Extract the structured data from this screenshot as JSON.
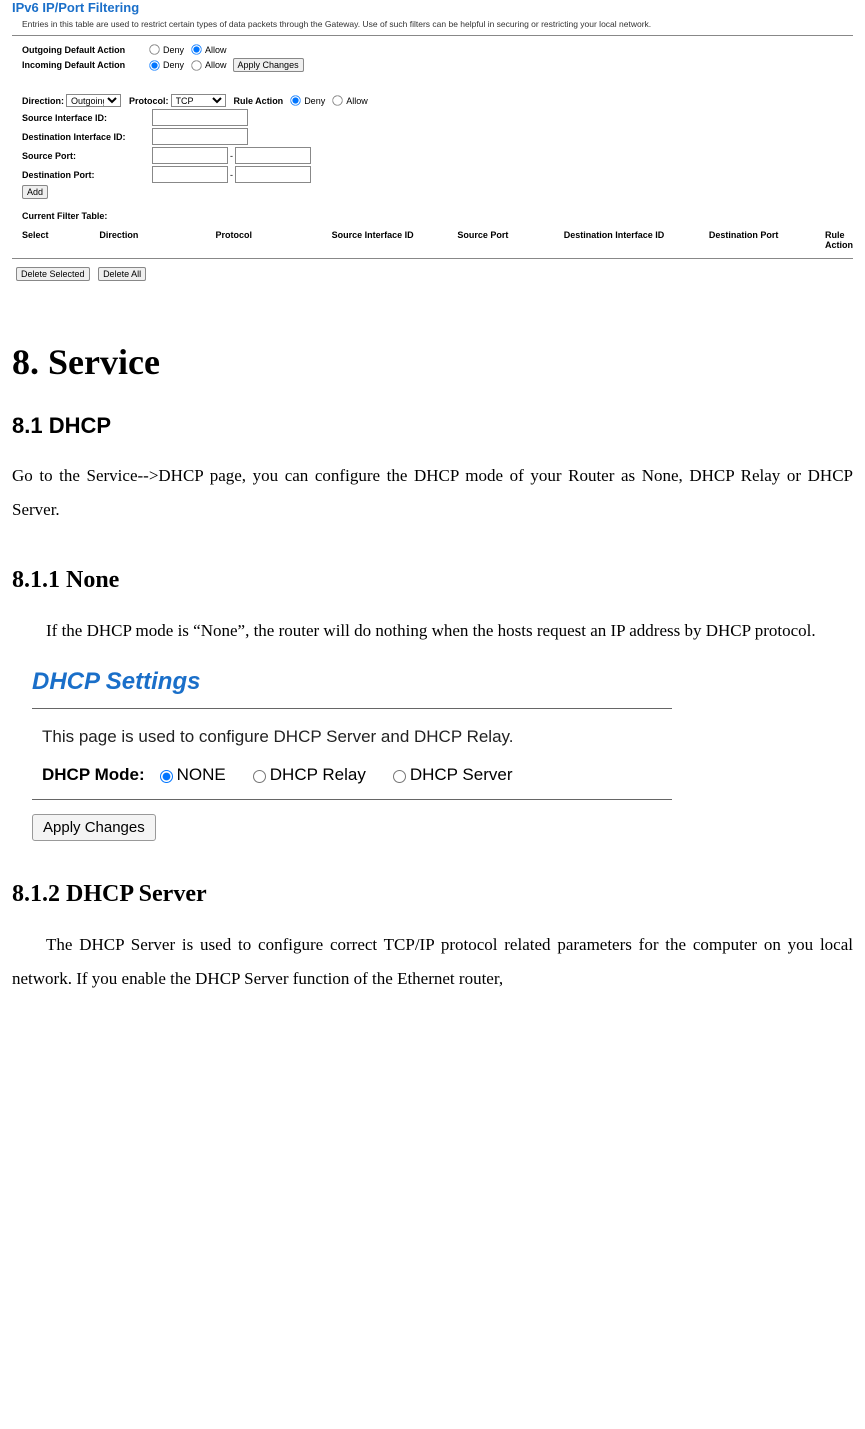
{
  "routerPanel": {
    "title": "IPv6 IP/Port Filtering",
    "desc": "Entries in this table are used to restrict certain types of data packets through the Gateway. Use of such filters can be helpful in securing or restricting your local network.",
    "outgoingLabel": "Outgoing Default Action",
    "incomingLabel": "Incoming Default Action",
    "deny": "Deny",
    "allow": "Allow",
    "applyChanges": "Apply Changes",
    "directionLabel": "Direction:",
    "directionValue": "Outgoing",
    "protocolLabel": "Protocol:",
    "protocolValue": "TCP",
    "ruleActionLabel": "Rule Action",
    "srcIfId": "Source Interface ID:",
    "dstIfId": "Destination Interface ID:",
    "srcPort": "Source Port:",
    "dstPort": "Destination Port:",
    "add": "Add",
    "currentFilterTable": "Current Filter Table:",
    "th": {
      "select": "Select",
      "direction": "Direction",
      "protocol": "Protocol",
      "srcIf": "Source Interface ID",
      "srcPort": "Source Port",
      "dstIf": "Destination Interface ID",
      "dstPort": "Destination Port",
      "ruleAction": "Rule Action"
    },
    "deleteSelected": "Delete Selected",
    "deleteAll": "Delete All"
  },
  "doc": {
    "h1": "8. Service",
    "h2_dhcp": "8.1 DHCP",
    "p_dhcp": "Go to the Service-->DHCP page, you can configure the DHCP mode of your Router as None, DHCP Relay or DHCP Server.",
    "h2_none": "8.1.1 None",
    "p_none": "If the DHCP mode is “None”, the router will do nothing when the hosts request an IP address by DHCP protocol.",
    "h2_server": "8.1.2 DHCP Server",
    "p_server": "The DHCP Server is used to configure correct TCP/IP protocol related parameters for the computer on you local network. If you enable the DHCP Server function of the Ethernet router,"
  },
  "dhcpPanel": {
    "title": "DHCP Settings",
    "desc": "This page is used to configure DHCP Server and DHCP Relay.",
    "modeLabel": "DHCP Mode:",
    "optNone": "NONE",
    "optRelay": "DHCP Relay",
    "optServer": "DHCP Server",
    "apply": "Apply Changes"
  }
}
